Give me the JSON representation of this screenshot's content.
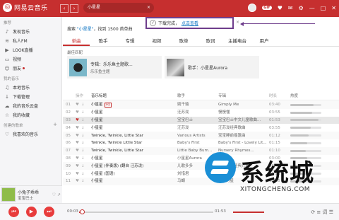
{
  "app": {
    "title": "网易云音乐",
    "logo_glyph": "◎"
  },
  "top": {
    "back": "‹",
    "forward": "›",
    "search_value": "小星星",
    "search_clear": "×",
    "icons": {
      "skin": "skin-icon",
      "settings": "gear-icon",
      "mail": "mail-icon",
      "min": "minimize-icon",
      "max": "maximize-icon",
      "close": "close-icon"
    },
    "badge": "GIF",
    "settings_glyph": "⚙",
    "mail_glyph": "✉",
    "skin_glyph": "♥",
    "min_glyph": "—",
    "max_glyph": "□",
    "close_glyph": "✕"
  },
  "sidebar": {
    "sec_recommend": "推荐",
    "recommend": [
      {
        "icon": "♪",
        "label": "发现音乐"
      },
      {
        "icon": "≋",
        "label": "私人FM"
      },
      {
        "icon": "▶",
        "label": "LOOK直播"
      },
      {
        "icon": "▭",
        "label": "视频"
      },
      {
        "icon": "☺",
        "label": "朋友"
      }
    ],
    "sec_mine": "我的音乐",
    "mine": [
      {
        "icon": "♫",
        "label": "本地音乐"
      },
      {
        "icon": "↓",
        "label": "下载管理"
      },
      {
        "icon": "☁",
        "label": "我的音乐云盘"
      },
      {
        "icon": "☆",
        "label": "我的收藏"
      }
    ],
    "sec_playlists": "创建的歌单",
    "playlists_add": "+",
    "playlists": [
      {
        "icon": "♡",
        "label": "我喜欢的音乐"
      }
    ]
  },
  "now_playing": {
    "title": "小兔子乖乖",
    "artist": "宝宝巴士",
    "icons": "♡ ↗"
  },
  "main": {
    "result_prefix": "搜索 ",
    "result_keyword": "\"小星星\"",
    "result_suffix": "，找到 1500 首单曲",
    "toast": {
      "text": "下载完成，",
      "link": "点击查看",
      "ok": "✓",
      "close": "×"
    },
    "tabs": [
      "单曲",
      "歌手",
      "专辑",
      "视频",
      "歌单",
      "歌词",
      "主播电台",
      "用户"
    ],
    "active_tab": "单曲",
    "best_label": "最佳匹配",
    "best": [
      {
        "title": "专辑：乐乐鱼主题歌...",
        "sub": "乐乐鱼主题"
      },
      {
        "title": "歌手：小星星Aurora",
        "sub": ""
      }
    ],
    "columns": {
      "op": "操作",
      "title": "音乐标题",
      "artist": "歌手",
      "album": "专辑",
      "duration": "时长",
      "pop": "热度"
    },
    "rows": [
      {
        "no": "01",
        "title": "小星星",
        "tag": "SQ",
        "artist": "姚千瑜",
        "album": "Gimply Me",
        "duration": "03:40",
        "pop": 0.75
      },
      {
        "no": "02",
        "title": "小星星",
        "tag": "",
        "artist": "汪苏泷",
        "album": "慢慢懂",
        "duration": "03:55",
        "pop": 0.7
      },
      {
        "no": "03",
        "title": "小星星",
        "tag": "",
        "artist": "宝宝巴士",
        "album": "宝宝巴士中文儿童歌曲...",
        "duration": "01:53",
        "pop": 0.9,
        "playing": true
      },
      {
        "no": "04",
        "title": "小星星",
        "tag": "",
        "artist": "汪苏泷",
        "album": "汪苏泷经典歌曲",
        "duration": "03:55",
        "pop": 0.65
      },
      {
        "no": "05",
        "title": "Twinkle, Twinkle, Little Star",
        "tag": "",
        "artist": "Various Artists",
        "album": "宝宝睡前摇篮曲",
        "duration": "01:12",
        "pop": 0.6
      },
      {
        "no": "06",
        "title": "Twinkle, Twinkle Little Star",
        "tag": "",
        "artist": "Baby's First",
        "album": "Baby's First - Lovely Lit...",
        "duration": "01:15",
        "pop": 0.55
      },
      {
        "no": "07",
        "title": "Twinkle, Twinkle, Little Star",
        "tag": "",
        "artist": "Little Baby Bum...",
        "album": "Nursery Rhymes...",
        "duration": "01:10",
        "pop": 0.5
      },
      {
        "no": "08",
        "title": "小星星",
        "tag": "",
        "artist": "小星星Aurora",
        "album": "小星星",
        "duration": "03:00",
        "pop": 0.55
      },
      {
        "no": "09",
        "title": "小星星 (伴奏版) (翻自 汪苏泷)",
        "tag": "",
        "artist": "儿歌多多",
        "album": "儿歌多多经典儿歌",
        "duration": "02:47",
        "pop": 0.45
      },
      {
        "no": "10",
        "title": "小星星 (国语)",
        "tag": "",
        "artist": "刘惜君",
        "album": "新世",
        "duration": "01:28",
        "pop": 0.45
      },
      {
        "no": "11",
        "title": "小星星",
        "tag": "",
        "artist": "马頔",
        "album": "贝贝的星",
        "duration": "03:45",
        "pop": 0.4
      }
    ]
  },
  "player": {
    "prev": "⏮",
    "play": "▶",
    "next": "⏭",
    "current_time": "00:03",
    "total_time": "01:53",
    "icons": "⟳ ≡ 词 ☰"
  },
  "watermark": {
    "text": "系统城",
    "url": "XITONGCHENG.COM"
  }
}
